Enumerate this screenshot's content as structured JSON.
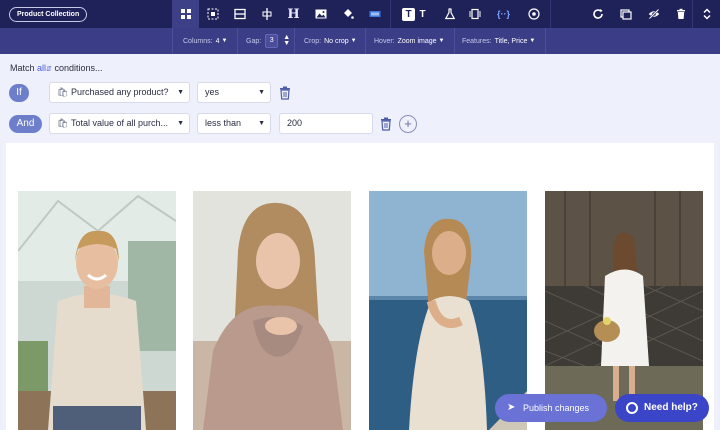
{
  "toolbar": {
    "badge_label": "Product Collection",
    "heading_glyph": "H",
    "text_glyph_a": "T",
    "text_glyph_b": "T",
    "code_glyph": "{··}"
  },
  "options": {
    "columns_label": "Columns:",
    "columns_value": "4",
    "gap_label": "Gap:",
    "gap_value": "3",
    "crop_label": "Crop:",
    "crop_value": "No crop",
    "hover_label": "Hover:",
    "hover_value": "Zoom image",
    "features_label": "Features:",
    "features_value": "Title, Price"
  },
  "conditions": {
    "match_prefix": "Match",
    "match_mode": "all",
    "match_suffix": "conditions...",
    "rows": [
      {
        "connector": "If",
        "field": "Purchased any product?",
        "operator": "yes",
        "value": null
      },
      {
        "connector": "And",
        "field": "Total value of all purch...",
        "operator": "less than",
        "value": "200"
      }
    ]
  },
  "gallery": {
    "columns": 4,
    "items": [
      {
        "subject": "woman-in-greenhouse",
        "palette": {
          "bg": "#c9d6cf",
          "shirt": "#e6dccd",
          "hair": "#c59a5a",
          "ground": "#8d7458"
        }
      },
      {
        "subject": "woman-in-pink-sweater",
        "palette": {
          "bg": "#dfe1da",
          "shirt": "#bb9a8e",
          "hair": "#a9835a",
          "ground": "#b99d88"
        }
      },
      {
        "subject": "woman-by-the-sea",
        "palette": {
          "bg": "#8fb4d2",
          "sea": "#2f5e84",
          "dress": "#e9e0d2",
          "hair": "#b58a54"
        }
      },
      {
        "subject": "woman-with-basket",
        "palette": {
          "bg": "#5c5246",
          "dress": "#f4f2ee",
          "fence": "#3e3a35",
          "ground": "#6d6a58"
        }
      }
    ]
  },
  "actions": {
    "publish_label": "Publish changes",
    "help_label": "Need help?"
  },
  "colors": {
    "toolbar_bg": "#1f2159",
    "subbar_bg": "#3b3d86",
    "accent": "#3a45c8",
    "tag_bg": "#6d7ecb"
  }
}
